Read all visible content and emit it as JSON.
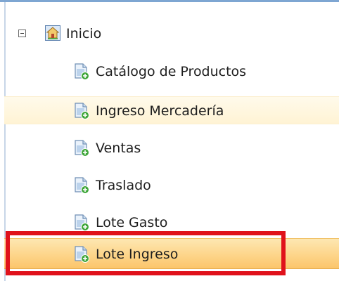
{
  "tree": {
    "root": {
      "label": "Inicio",
      "icon": "home-icon",
      "expanded": true
    },
    "items": [
      {
        "label": "Catálogo de Productos",
        "icon": "document-add-icon",
        "state": "normal"
      },
      {
        "label": "Ingreso Mercadería",
        "icon": "document-add-icon",
        "state": "hover"
      },
      {
        "label": "Ventas",
        "icon": "document-add-icon",
        "state": "normal"
      },
      {
        "label": "Traslado",
        "icon": "document-add-icon",
        "state": "normal"
      },
      {
        "label": "Lote Gasto",
        "icon": "document-add-icon",
        "state": "normal"
      },
      {
        "label": "Lote Ingreso",
        "icon": "document-add-icon",
        "state": "selected"
      }
    ]
  },
  "colors": {
    "hover_row": "#fff3d4",
    "selected_row": "#fdd58a",
    "annotation_box": "#e0121b"
  }
}
